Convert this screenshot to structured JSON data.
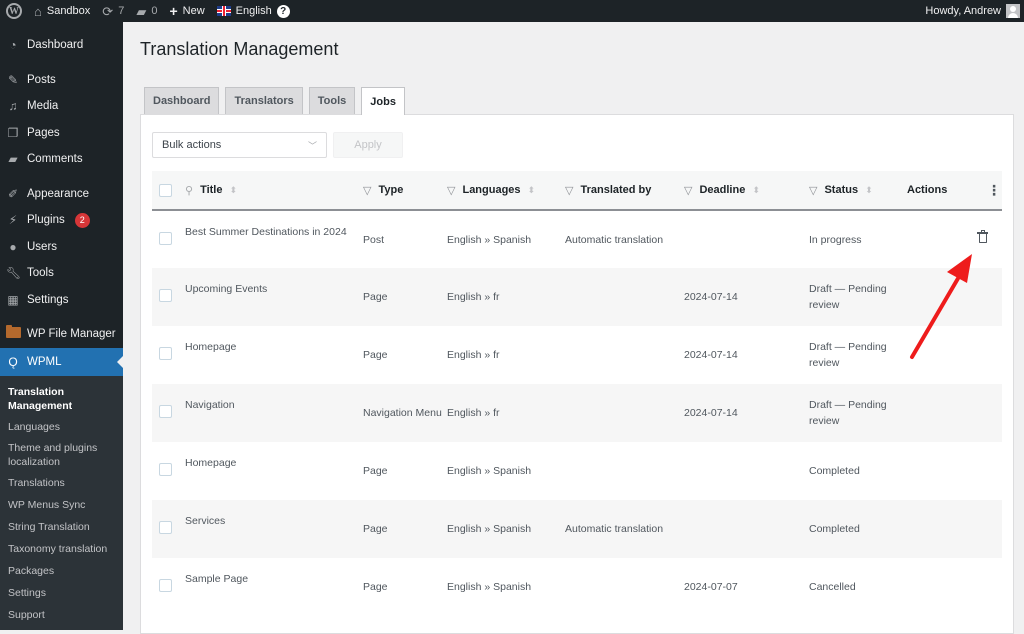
{
  "adminbar": {
    "site_name": "Sandbox",
    "updates_count": "7",
    "comments_count": "0",
    "new_label": "New",
    "language_label": "English",
    "help_glyph": "?",
    "greeting": "Howdy, Andrew",
    "icons": {
      "wp_logo": "wordpress-icon",
      "home": "home-icon",
      "updates": "refresh-icon",
      "comments": "comment-icon",
      "new": "plus-icon",
      "flag": "uk-flag-icon",
      "help": "help-icon",
      "avatar": "avatar-icon"
    }
  },
  "sidebar": {
    "items": [
      {
        "label": "Dashboard",
        "icon": "dashboard-icon"
      },
      {
        "label": "Posts",
        "icon": "pin-icon"
      },
      {
        "label": "Media",
        "icon": "media-icon"
      },
      {
        "label": "Pages",
        "icon": "pages-icon"
      },
      {
        "label": "Comments",
        "icon": "comment-icon"
      },
      {
        "label": "Appearance",
        "icon": "brush-icon"
      },
      {
        "label": "Plugins",
        "icon": "plugin-icon",
        "badge": "2"
      },
      {
        "label": "Users",
        "icon": "user-icon"
      },
      {
        "label": "Tools",
        "icon": "wrench-icon"
      },
      {
        "label": "Settings",
        "icon": "settings-icon"
      },
      {
        "label": "WP File Manager",
        "icon": "folder-icon"
      },
      {
        "label": "WPML",
        "icon": "wpml-icon",
        "current": true
      }
    ],
    "submenu": [
      {
        "label": "Translation Management",
        "current": true
      },
      {
        "label": "Languages"
      },
      {
        "label": "Theme and plugins localization"
      },
      {
        "label": "Translations"
      },
      {
        "label": "WP Menus Sync"
      },
      {
        "label": "String Translation"
      },
      {
        "label": "Taxonomy translation"
      },
      {
        "label": "Packages"
      },
      {
        "label": "Settings"
      },
      {
        "label": "Support"
      }
    ]
  },
  "page": {
    "title": "Translation Management",
    "tabs": [
      {
        "label": "Dashboard",
        "active": false
      },
      {
        "label": "Translators",
        "active": false
      },
      {
        "label": "Tools",
        "active": false
      },
      {
        "label": "Jobs",
        "active": true
      }
    ],
    "bulk_actions": {
      "selected": "Bulk actions"
    },
    "apply_label": "Apply"
  },
  "table": {
    "columns": {
      "title": "Title",
      "type": "Type",
      "languages": "Languages",
      "translated_by": "Translated by",
      "deadline": "Deadline",
      "status": "Status",
      "actions": "Actions"
    },
    "rows": [
      {
        "title": "Best Summer Destinations in 2024",
        "type": "Post",
        "languages": "English » Spanish",
        "translated_by": "Automatic translation",
        "deadline": "",
        "status": "In progress",
        "action": "trash-icon"
      },
      {
        "title": "Upcoming Events",
        "type": "Page",
        "languages": "English » fr",
        "translated_by": "",
        "deadline": "2024-07-14",
        "status": "Draft — Pending review",
        "action": ""
      },
      {
        "title": "Homepage",
        "type": "Page",
        "languages": "English » fr",
        "translated_by": "",
        "deadline": "2024-07-14",
        "status": "Draft — Pending review",
        "action": ""
      },
      {
        "title": "Navigation",
        "type": "Navigation Menu",
        "languages": "English » fr",
        "translated_by": "",
        "deadline": "2024-07-14",
        "status": "Draft — Pending review",
        "action": ""
      },
      {
        "title": "Homepage",
        "type": "Page",
        "languages": "English » Spanish",
        "translated_by": "",
        "deadline": "",
        "status": "Completed",
        "action": ""
      },
      {
        "title": "Services",
        "type": "Page",
        "languages": "English » Spanish",
        "translated_by": "Automatic translation",
        "deadline": "",
        "status": "Completed",
        "action": ""
      },
      {
        "title": "Sample Page",
        "type": "Page",
        "languages": "English » Spanish",
        "translated_by": "",
        "deadline": "2024-07-07",
        "status": "Cancelled",
        "action": ""
      }
    ]
  },
  "annotation": {
    "arrow_color": "#ee1c1c",
    "points_to": "trash-icon"
  },
  "colors": {
    "accent": "#2271b1",
    "adminbar": "#1d2327",
    "badge": "#d63638"
  }
}
